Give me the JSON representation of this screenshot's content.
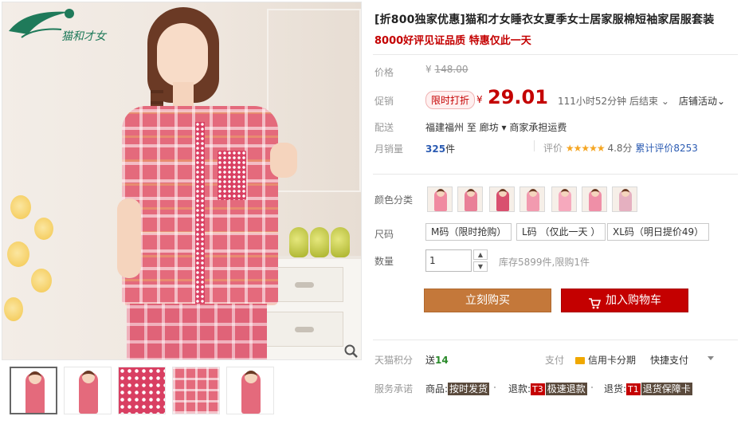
{
  "product": {
    "title": "[折800独家优惠]猫和才女睡衣女夏季女士居家服棉短袖家居服套装",
    "subtitle": "8000好评见证品质 特惠仅此一天"
  },
  "price": {
    "label": "价格",
    "currency": "¥",
    "original": "148.00"
  },
  "promo": {
    "label": "促销",
    "tag": "限时打折",
    "currency": "¥",
    "price": "29.01",
    "countdown": "111小时52分钟 后结束",
    "shop_activity": "店铺活动"
  },
  "shipping": {
    "label": "配送",
    "from": "福建福州",
    "to_word": "至",
    "to": "廊坊",
    "fee": "商家承担运费"
  },
  "sales": {
    "label": "月销量",
    "count": "325",
    "unit": "件",
    "rating_label": "评价",
    "stars": "★★★★★",
    "score": "4.8分",
    "cumulative": "累计评价8253"
  },
  "color": {
    "label": "颜色分类",
    "swatch_colors": [
      "#f08aa0",
      "#e97f97",
      "#d9506f",
      "#f29aaf",
      "#f6a9bd",
      "#ef8fa7",
      "#e5b0c0"
    ]
  },
  "size": {
    "label": "尺码",
    "options": [
      "M码（限时抢购）",
      "L码 （仅此一天 ）",
      "XL码（明日提价49）"
    ]
  },
  "quantity": {
    "label": "数量",
    "value": "1",
    "up": "▲",
    "down": "▼",
    "stock": "库存5899件,限购1件"
  },
  "actions": {
    "buy_now": "立刻购买",
    "add_to_cart": "加入购物车"
  },
  "points": {
    "label": "天猫积分",
    "prefix": "送",
    "value": "14",
    "pay_label": "支付",
    "credit": "信用卡分期",
    "quickpay": "快捷支付"
  },
  "promise": {
    "label": "服务承诺",
    "goods_label": "商品:",
    "goods_badge": "按时发货",
    "refund_label": "退款:",
    "refund_tag": "T3",
    "refund_badge": "极速退款",
    "return_label": "退货:",
    "return_tag": "T1",
    "return_badge": "退货保障卡"
  },
  "brand": {
    "logo_text": "猫和才女"
  },
  "colors": {
    "accent_red": "#c40000",
    "buy_brown": "#c4783a",
    "link_blue": "#2b5bb2",
    "star_gold": "#f5a623"
  }
}
